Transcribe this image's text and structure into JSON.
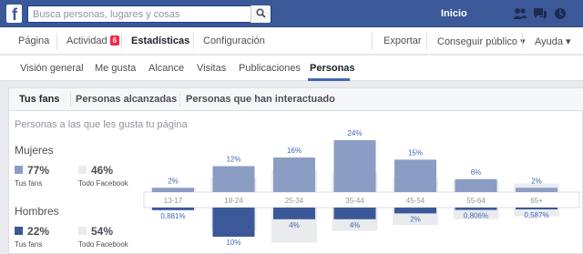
{
  "topbar": {
    "search_placeholder": "Busca personas, lugares y cosas",
    "home_label": "Inicio",
    "logo_letter": "f"
  },
  "pagebar": {
    "left_items": [
      {
        "label": "Página"
      },
      {
        "label": "Actividad",
        "badge": "6"
      },
      {
        "label": "Estadísticas"
      },
      {
        "label": "Configuración"
      }
    ],
    "right_items": [
      {
        "label": "Exportar"
      },
      {
        "label": "Conseguir público ▾"
      },
      {
        "label": "Ayuda ▾"
      }
    ]
  },
  "subnav": {
    "items": [
      "Visión general",
      "Me gusta",
      "Alcance",
      "Visitas",
      "Publicaciones",
      "Personas"
    ],
    "active": "Personas"
  },
  "tabs": [
    "Tus fans",
    "Personas alcanzadas",
    "Personas que han interactuado"
  ],
  "section_title": "Personas a las que les gusta tu página",
  "women": {
    "label": "Mujeres",
    "your_fans_value": "77%",
    "your_fans_label": "Tus fans",
    "all_fb_value": "46%",
    "all_fb_label": "Todo Facebook"
  },
  "men": {
    "label": "Hombres",
    "your_fans_value": "22%",
    "your_fans_label": "Tus fans",
    "all_fb_value": "54%",
    "all_fb_label": "Todo Facebook"
  },
  "colors": {
    "fb_blue": "#3b5998",
    "women_fans": "#8b9dc3",
    "men_fans": "#3b5998",
    "all_facebook": "#e9ebee",
    "label_women": "#4267b2",
    "label_men": "#4267b2"
  },
  "chart_data": {
    "type": "bar",
    "categories": [
      "13-17",
      "18-24",
      "25-34",
      "35-44",
      "45-54",
      "55-64",
      "65+"
    ],
    "series": [
      {
        "name": "Mujeres",
        "values": [
          2,
          12,
          16,
          24,
          15,
          6,
          2
        ],
        "labels": [
          "2%",
          "12%",
          "16%",
          "24%",
          "15%",
          "6%",
          "2%"
        ]
      },
      {
        "name": "Hombres",
        "values": [
          0.881,
          10,
          4,
          4,
          2,
          0.806,
          0.587
        ],
        "labels": [
          "0,881%",
          "10%",
          "4%",
          "4%",
          "2%",
          "0,806%",
          "0,587%"
        ]
      }
    ],
    "all_facebook": {
      "women": [
        2,
        7,
        10,
        9,
        7,
        5,
        4
      ],
      "men": [
        1,
        8,
        12,
        8,
        6,
        4,
        3
      ]
    },
    "xlabel": "",
    "ylabel": ""
  }
}
